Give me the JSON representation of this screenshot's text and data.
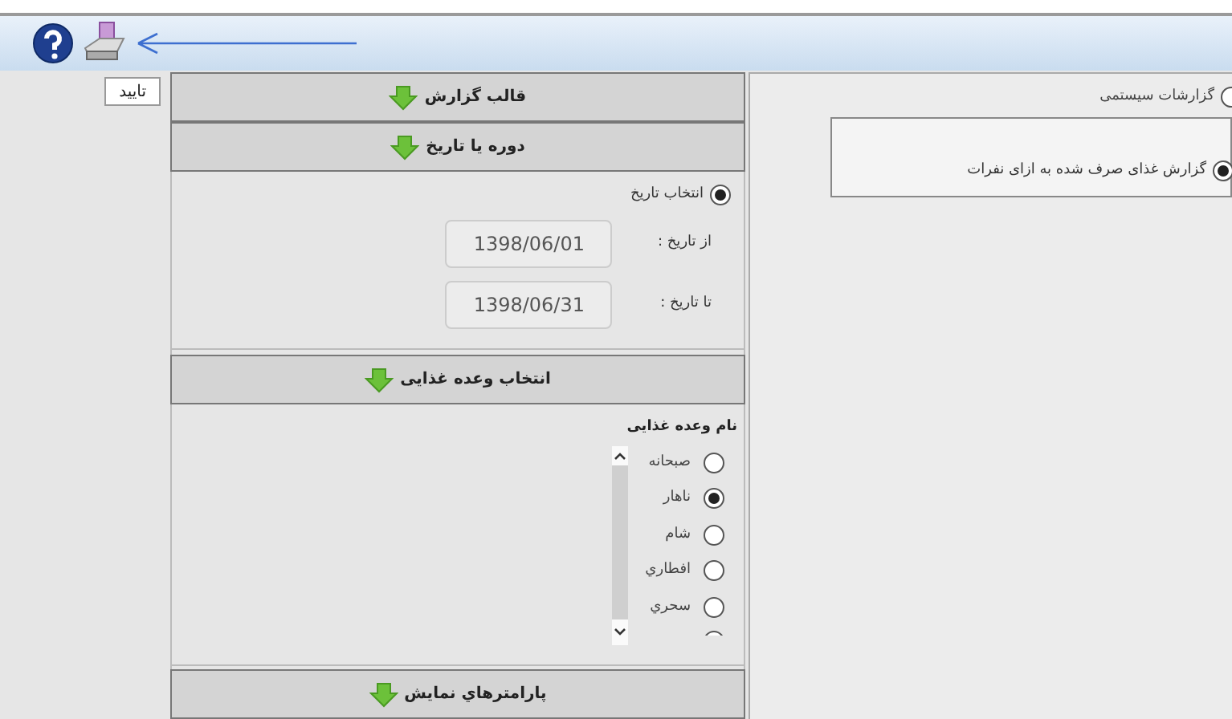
{
  "sidebar": {
    "confirm_button": "تایید"
  },
  "accordion": [
    {
      "title": "قالب گزارش",
      "kind": "header"
    },
    {
      "title": "دوره یا تاریخ",
      "kind": "date",
      "radio": {
        "label": "انتخاب تاریخ",
        "selected": true
      },
      "from": {
        "label": "از تاریخ :",
        "value": "1398/06/01"
      },
      "to": {
        "label": "تا تاریخ :",
        "value": "1398/06/31"
      }
    },
    {
      "title": "انتخاب وعده غذایی",
      "kind": "meals",
      "list_label": "نام وعده غذایی",
      "meals": [
        {
          "label": "صبحانه",
          "selected": false
        },
        {
          "label": "ناهار",
          "selected": true
        },
        {
          "label": "شام",
          "selected": false
        },
        {
          "label": "افطاري",
          "selected": false
        },
        {
          "label": "سحري",
          "selected": false
        }
      ],
      "cut_item": {
        "selected": false
      }
    },
    {
      "title": "پارامترهاي نمايش",
      "kind": "header"
    }
  ],
  "reports": {
    "group": {
      "label": "گزارشات سیستمی",
      "selected": false
    },
    "items": [
      {
        "label": "گزارش غذای صرف شده به ازای نفرات",
        "selected": true
      }
    ]
  }
}
